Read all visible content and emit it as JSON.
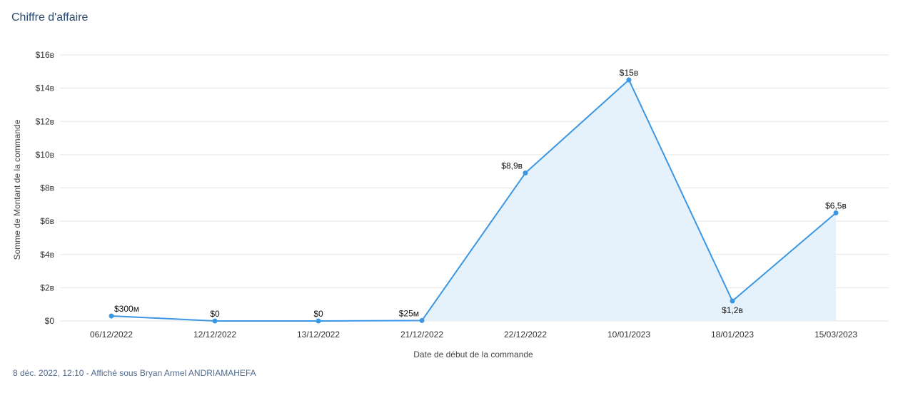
{
  "title": "Chiffre d'affaire",
  "footer": "8 déc. 2022, 12:10 - Affiché sous Bryan Armel ANDRIAMAHEFA",
  "colors": {
    "line": "#3b97e3",
    "area": "#e6f2fb",
    "grid": "#e5e5e5",
    "title": "#2b4a6f"
  },
  "chart_data": {
    "type": "area",
    "xlabel": "Date de début de la commande",
    "ylabel": "Somme de Montant de la commande",
    "ylim": [
      0,
      16
    ],
    "y_ticks": [
      {
        "value": 0,
        "label": "$0"
      },
      {
        "value": 2,
        "label": "$2в"
      },
      {
        "value": 4,
        "label": "$4в"
      },
      {
        "value": 6,
        "label": "$6в"
      },
      {
        "value": 8,
        "label": "$8в"
      },
      {
        "value": 10,
        "label": "$10в"
      },
      {
        "value": 12,
        "label": "$12в"
      },
      {
        "value": 14,
        "label": "$14в"
      },
      {
        "value": 16,
        "label": "$16в"
      }
    ],
    "categories": [
      "06/12/2022",
      "12/12/2022",
      "13/12/2022",
      "21/12/2022",
      "22/12/2022",
      "10/01/2023",
      "18/01/2023",
      "15/03/2023"
    ],
    "values": [
      0.3,
      0,
      0,
      0.025,
      8.9,
      14.5,
      1.2,
      6.5
    ],
    "data_labels": [
      "$300м",
      "$0",
      "$0",
      "$25м",
      "$8,9в",
      "$15в",
      "$1,2в",
      "$6,5в"
    ],
    "shaded_from_index": 3,
    "grid": true
  }
}
